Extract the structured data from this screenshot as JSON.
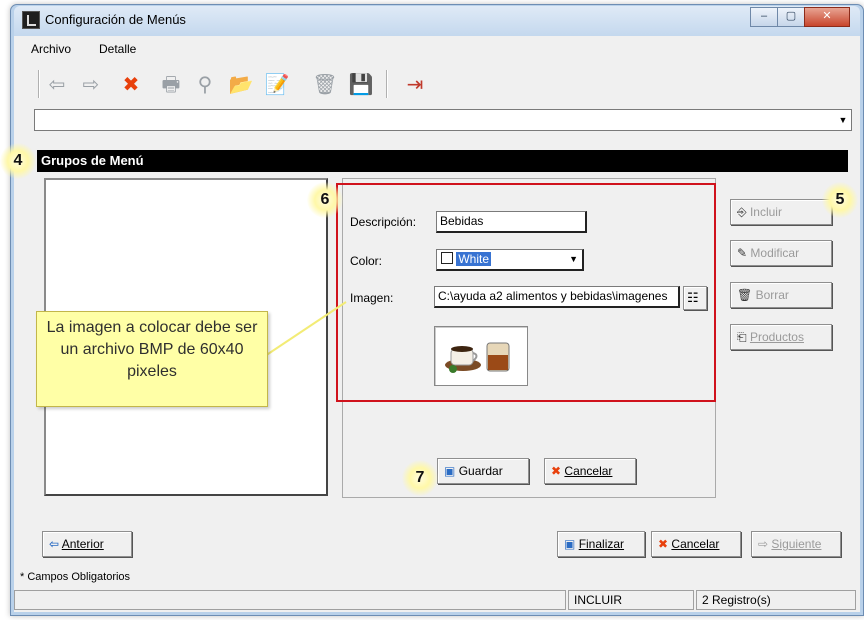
{
  "window": {
    "title": "Configuración de Menús",
    "minimize": "–",
    "maximize": "▢",
    "close": "✕"
  },
  "menubar": {
    "archivo": "Archivo",
    "detalle": "Detalle"
  },
  "toolbar": {
    "back_icon": "⇦",
    "forward_icon": "⇨",
    "delete_icon": "✖",
    "print_icon": "🖶",
    "search_icon": "⚲",
    "open_icon": "📂",
    "edit_icon": "📝",
    "trash_icon": "🗑",
    "save_icon": "💾",
    "exit_icon": "⇥"
  },
  "section": {
    "title": "Grupos de Menú"
  },
  "form": {
    "descripcion_label": "Descripción:",
    "descripcion_value": "Bebidas",
    "color_label": "Color:",
    "color_value": "White",
    "imagen_label": "Imagen:",
    "imagen_value": "C:\\ayuda a2 alimentos y bebidas\\imagenes"
  },
  "side_buttons": {
    "incluir": "Incluir",
    "modificar": "Modificar",
    "borrar": "Borrar",
    "productos": "Productos"
  },
  "form_buttons": {
    "guardar": "Guardar",
    "cancelar": "Cancelar"
  },
  "nav_buttons": {
    "anterior": "Anterior",
    "finalizar": "Finalizar",
    "cancelar": "Cancelar",
    "siguiente": "Siguiente"
  },
  "callout": {
    "text": "La imagen a colocar debe ser un archivo BMP de 60x40 pixeles"
  },
  "badges": {
    "b4": "4",
    "b5": "5",
    "b6": "6",
    "b7": "7"
  },
  "footer_note": "* Campos Obligatorios",
  "status": {
    "mode": "INCLUIR",
    "count": "2 Registro(s)"
  },
  "colors": {
    "accent_red": "#d0121c",
    "header_black": "#000000",
    "callout_yellow": "#ffffa6"
  }
}
